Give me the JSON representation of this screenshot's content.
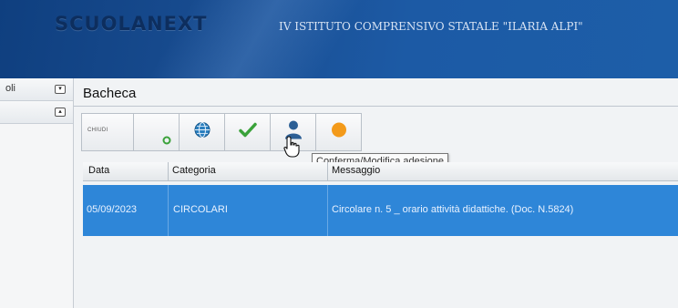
{
  "header": {
    "brand": "SCUOLANEXT",
    "school_name": "IV ISTITUTO COMPRENSIVO STATALE \"ILARIA ALPI\""
  },
  "sidebar": {
    "items": [
      {
        "label": "oli",
        "toggle": "▾"
      },
      {
        "label": "",
        "toggle": "▴"
      }
    ]
  },
  "panel": {
    "title": "Bacheca"
  },
  "toolbar": {
    "buttons": [
      {
        "label": "CHIUDI",
        "icon": "close-text"
      },
      {
        "label": "",
        "icon": "attachment-icon"
      },
      {
        "label": "",
        "icon": "globe-icon"
      },
      {
        "label": "",
        "icon": "checkmark-icon"
      },
      {
        "label": "",
        "icon": "user-confirm-icon"
      },
      {
        "label": "",
        "icon": "orange-circle-icon"
      }
    ],
    "tooltip": "Conferma/Modifica adesione"
  },
  "grid": {
    "columns": [
      "Data",
      "Categoria",
      "Messaggio"
    ],
    "rows": [
      {
        "data": "05/09/2023",
        "categoria": "CIRCOLARI",
        "messaggio": "Circolare n. 5 _ orario attività didattiche. (Doc. N.5824)",
        "selected": true
      }
    ]
  },
  "colors": {
    "header": "#1a4f94",
    "selected_row": "#2e86d8",
    "check": "#3aa23a",
    "orange": "#f39a1a"
  }
}
